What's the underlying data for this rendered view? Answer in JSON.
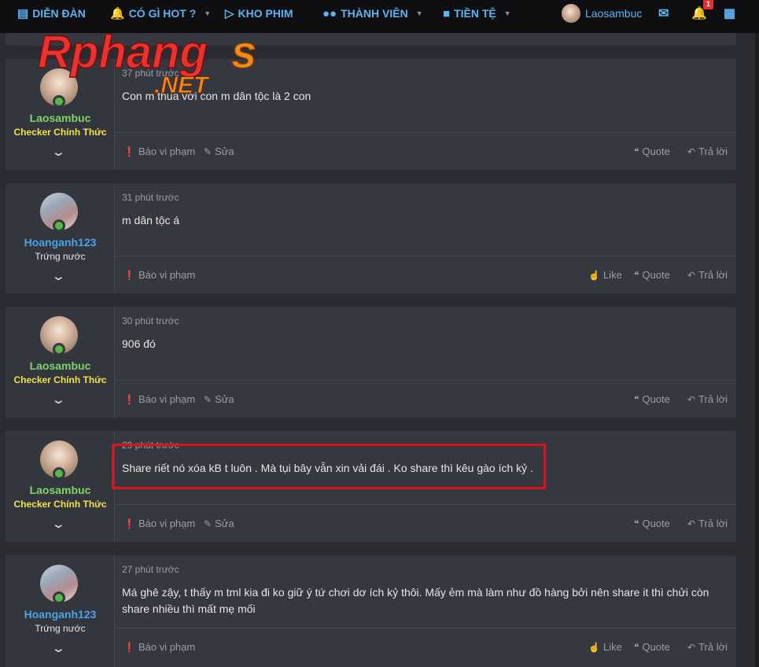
{
  "nav": {
    "forum": "DIỄN ĐÀN",
    "hot": "CÓ GÌ HOT ?",
    "movies": "KHO PHIM",
    "members": "THÀNH VIÊN",
    "currency": "TIỀN TỆ",
    "username": "Laosambuc",
    "alert_count": "1",
    "icons": [
      "forum-icon",
      "bell-icon",
      "video-icon",
      "members-icon",
      "folder-icon",
      "mail-icon",
      "bell-icon",
      "store-icon"
    ]
  },
  "logo": {
    "main": "Rphang",
    "s": "s",
    "net": ".NET"
  },
  "labels": {
    "report": "Báo vi phạm",
    "edit": "Sửa",
    "like": "Like",
    "quote": "Quote",
    "reply": "Trả lời"
  },
  "posts": [
    {
      "author": "Laosambuc",
      "title": "Checker Chính Thức",
      "time": "37 phút trước",
      "content": "Con m thua với con m dân tộc là 2 con"
    },
    {
      "author": "Hoanganh123",
      "title": "Trứng nước",
      "time": "31 phút trước",
      "content": "m dân tộc á"
    },
    {
      "author": "Laosambuc",
      "title": "Checker Chính Thức",
      "time": "30 phút trước",
      "content": "906 đó"
    },
    {
      "author": "Laosambuc",
      "title": "Checker Chính Thức",
      "time": "29 phút trước",
      "content": "Share riết nó xóa kB t luôn . Mà tụi bây vẫn xin vải đái . Ko share thì kêu gào ích kỷ ."
    },
    {
      "author": "Hoanganh123",
      "title": "Trứng nước",
      "time": "27 phút trước",
      "content": "Má ghê zậy, t thấy m tml kia đi ko giữ ý tứ chơi dơ ích kỷ thôi. Mấy ẻm mà làm như đồ hàng bởi nên share it thì chửi còn share nhiều thì mất mẹ mối"
    }
  ],
  "colors": {
    "page_bg": "#2a2c31",
    "post_bg": "#35383e",
    "nav_bg": "#0f0f12",
    "nav_link": "#5fb3f0",
    "checker_name": "#7fd46b",
    "checker_title": "#f2e14c",
    "member_name": "#4aa3ea",
    "highlight_box": "#e0101e"
  }
}
